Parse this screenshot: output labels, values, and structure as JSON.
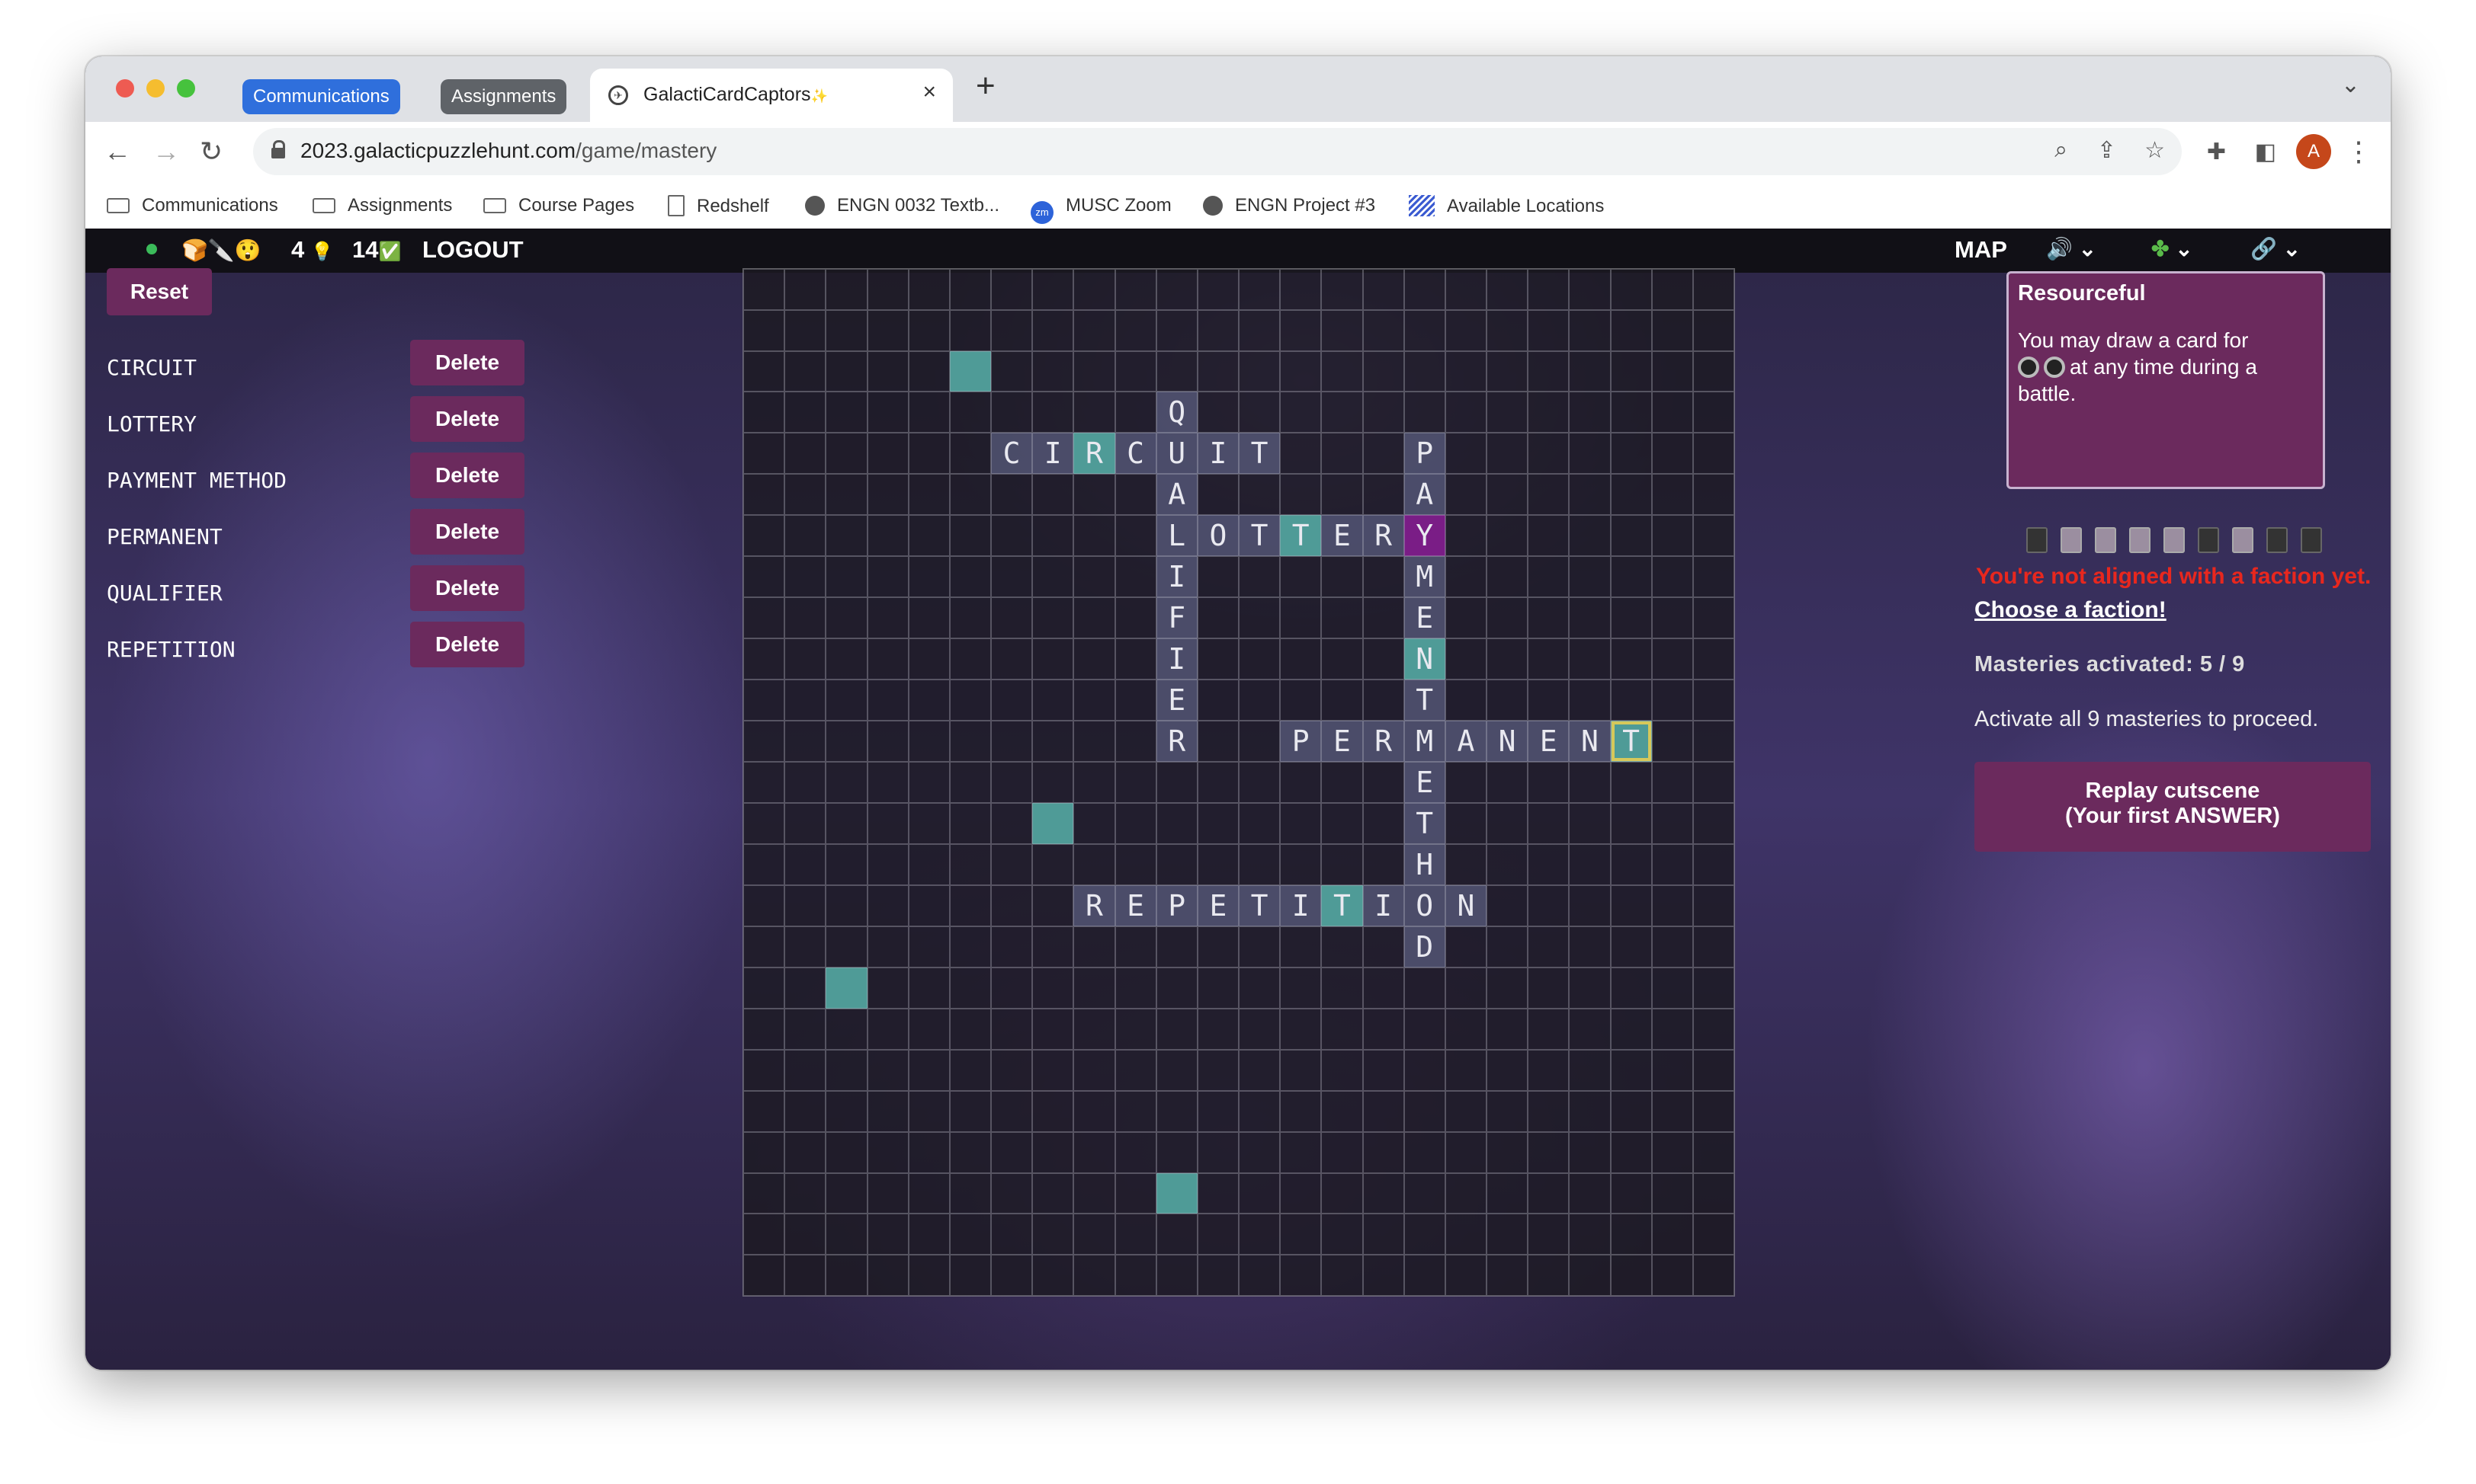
{
  "browser": {
    "tabs": [
      {
        "label": "Communications",
        "color": "#2f6fdc"
      },
      {
        "label": "Assignments",
        "color": "#5f6368"
      }
    ],
    "active_tab": {
      "title": "GalactiCardCaptors",
      "sparkle": "✨",
      "favicon": "spaceship-icon"
    },
    "url_host": "2023.galacticpuzzlehunt.com",
    "url_path": "/game/mastery",
    "avatar_letter": "A",
    "bookmarks": [
      {
        "label": "Communications",
        "icon": "folder-icon"
      },
      {
        "label": "Assignments",
        "icon": "folder-icon"
      },
      {
        "label": "Course Pages",
        "icon": "folder-icon"
      },
      {
        "label": "Redshelf",
        "icon": "document-icon"
      },
      {
        "label": "ENGN 0032 Textb...",
        "icon": "globe-icon"
      },
      {
        "label": "MUSC Zoom",
        "icon": "zoom-icon"
      },
      {
        "label": "ENGN Project #3",
        "icon": "globe-icon"
      },
      {
        "label": "Available Locations",
        "icon": "map-icon"
      }
    ]
  },
  "topbar": {
    "emojis": "🍞🔪😲",
    "hints_count": "4",
    "hint_icon": "💡",
    "solves_count": "14",
    "solve_icon": "✅",
    "logout": "LOGOUT",
    "map": "MAP"
  },
  "left": {
    "reset": "Reset",
    "delete_label": "Delete",
    "words": [
      "CIRCUIT",
      "LOTTERY",
      "PAYMENT METHOD",
      "PERMANENT",
      "QUALIFIER",
      "REPETITION"
    ]
  },
  "grid": {
    "rows": 25,
    "cols": 24,
    "words": [
      {
        "word": "CIRCUIT",
        "row": 4,
        "col": 6,
        "dir": "across"
      },
      {
        "word": "QUALIFIER",
        "row": 3,
        "col": 10,
        "dir": "down"
      },
      {
        "word": "PAYMENTMETHOD",
        "row": 4,
        "col": 16,
        "dir": "down"
      },
      {
        "word": "LOTTERY",
        "row": 6,
        "col": 10,
        "dir": "across"
      },
      {
        "word": "PERMANENT",
        "row": 11,
        "col": 13,
        "dir": "across"
      },
      {
        "word": "REPETITION",
        "row": 15,
        "col": 8,
        "dir": "across"
      }
    ],
    "teal_cells": [
      [
        2,
        5
      ],
      [
        4,
        8
      ],
      [
        6,
        13
      ],
      [
        9,
        16
      ],
      [
        13,
        7
      ],
      [
        15,
        14
      ],
      [
        17,
        2
      ],
      [
        22,
        10
      ]
    ],
    "purple_cells": [
      [
        6,
        16
      ]
    ],
    "selected_cell": [
      11,
      21
    ]
  },
  "right": {
    "card_title": "Resourceful",
    "card_text_before": "You may draw a card for",
    "card_text_after": "at any time during a battle.",
    "warning": "You're not aligned with a faction yet.",
    "choose_faction": "Choose a faction!",
    "masteries_label": "Masteries activated:",
    "masteries_value": "5 / 9",
    "activate_text": "Activate all 9 masteries to proceed.",
    "replay_line1": "Replay cutscene",
    "replay_line2": "(Your first ANSWER)",
    "card_icons": [
      "dark",
      "light",
      "light",
      "light",
      "light",
      "dark",
      "light",
      "dark",
      "dark"
    ]
  }
}
